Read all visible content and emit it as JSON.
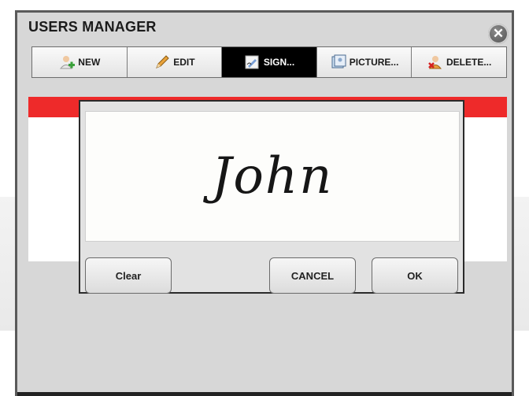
{
  "window": {
    "title": "USERS MANAGER"
  },
  "toolbar": {
    "items": [
      {
        "label": "NEW",
        "icon": "user-add-icon"
      },
      {
        "label": "EDIT",
        "icon": "pencil-icon"
      },
      {
        "label": "SIGN...",
        "icon": "signature-pen-icon",
        "active": true
      },
      {
        "label": "PICTURE...",
        "icon": "picture-icon"
      },
      {
        "label": "DELETE...",
        "icon": "user-delete-icon"
      }
    ]
  },
  "signature_dialog": {
    "signature_text": "John",
    "clear_label": "Clear",
    "cancel_label": "CANCEL",
    "ok_label": "OK"
  },
  "colors": {
    "accent_red": "#ee2a2a",
    "active_tab": "#000000"
  }
}
